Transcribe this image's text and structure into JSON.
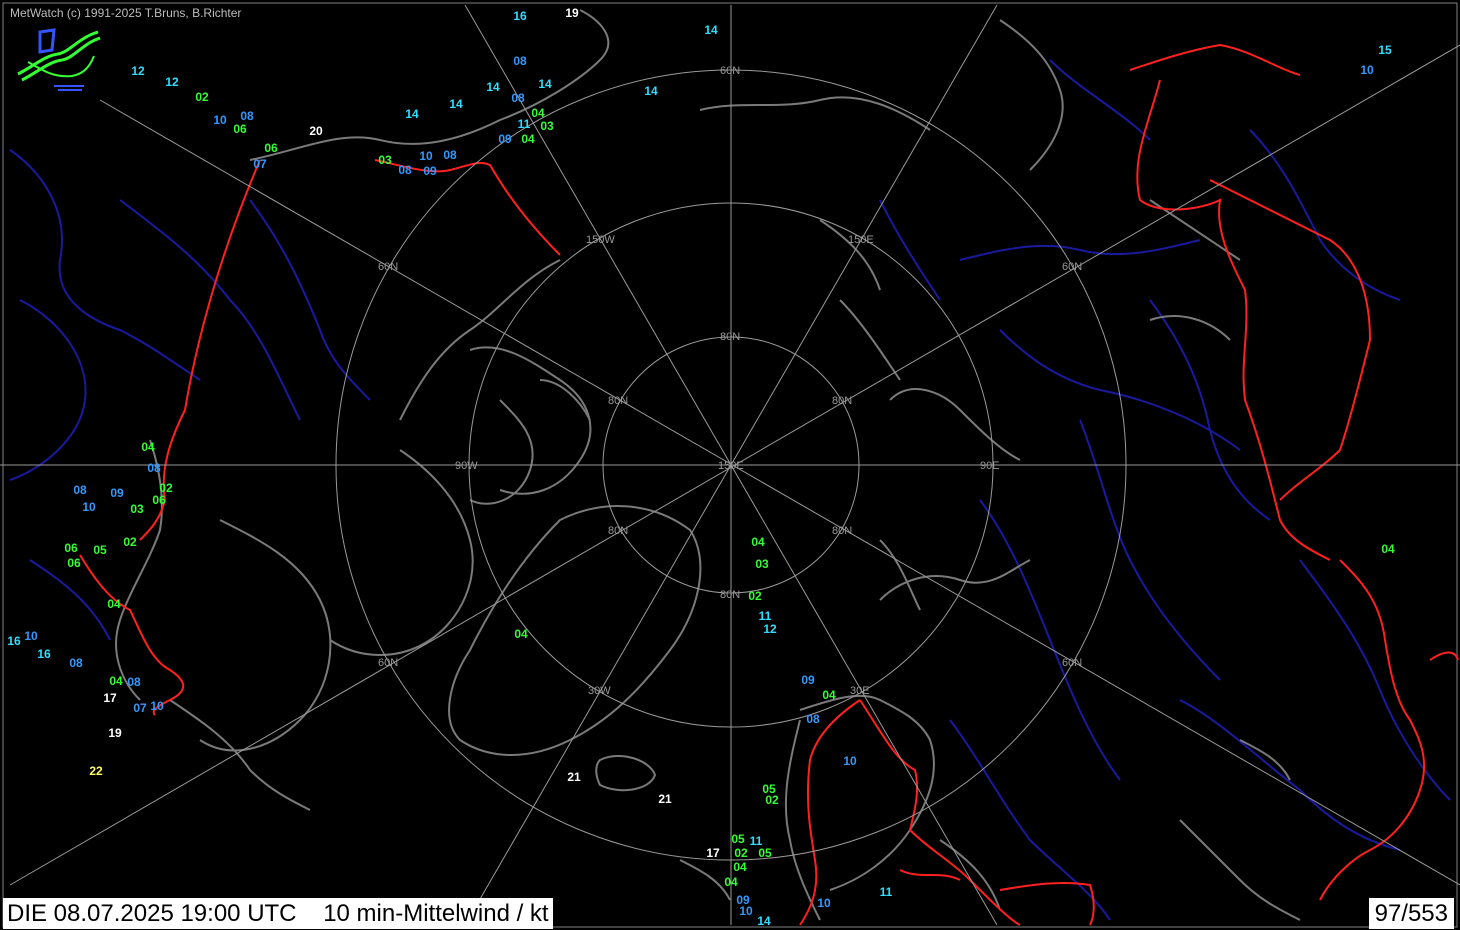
{
  "header": {
    "credit": "MetWatch  (c) 1991-2025 T.Bruns, B.Richter"
  },
  "footer": {
    "datetime": "DIE 08.07.2025 19:00 UTC",
    "product": "10 min-Mittelwind / kt",
    "counter": "97/553"
  },
  "grid_labels": {
    "lat60": "60N",
    "lat80": "80N",
    "center": "150E",
    "lon150w": "150W",
    "lon150e": "150E",
    "lon90w": "90W",
    "lon90e": "90E",
    "lon30w": "30W",
    "lon30e": "30E"
  },
  "colors": {
    "background": "#000000",
    "coastline": "#7a7a7a",
    "border": "#ff2020",
    "rivers": "#1a1a9e",
    "grid": "#9a9a9a",
    "wind_low": "#33ff33",
    "wind_mid": "#3399ff",
    "wind_high": "#33ddff",
    "wind_strong": "#ffffff",
    "wind_very_strong": "#ffff66"
  },
  "observations": [
    {
      "v": "16",
      "c": "wind_high"
    },
    {
      "v": "19",
      "c": "wind_strong"
    },
    {
      "v": "14",
      "c": "wind_high"
    },
    {
      "v": "08",
      "c": "wind_mid"
    },
    {
      "v": "14",
      "c": "wind_high"
    },
    {
      "v": "14",
      "c": "wind_high"
    },
    {
      "v": "08",
      "c": "wind_mid"
    },
    {
      "v": "04",
      "c": "wind_low"
    },
    {
      "v": "11",
      "c": "wind_high"
    },
    {
      "v": "03",
      "c": "wind_low"
    },
    {
      "v": "09",
      "c": "wind_mid"
    },
    {
      "v": "04",
      "c": "wind_low"
    },
    {
      "v": "14",
      "c": "wind_high"
    },
    {
      "v": "14",
      "c": "wind_high"
    },
    {
      "v": "14",
      "c": "wind_high"
    },
    {
      "v": "12",
      "c": "wind_high"
    },
    {
      "v": "12",
      "c": "wind_high"
    },
    {
      "v": "02",
      "c": "wind_low"
    },
    {
      "v": "10",
      "c": "wind_mid"
    },
    {
      "v": "08",
      "c": "wind_mid"
    },
    {
      "v": "06",
      "c": "wind_low"
    },
    {
      "v": "20",
      "c": "wind_strong"
    },
    {
      "v": "06",
      "c": "wind_low"
    },
    {
      "v": "07",
      "c": "wind_mid"
    },
    {
      "v": "03",
      "c": "wind_low"
    },
    {
      "v": "10",
      "c": "wind_mid"
    },
    {
      "v": "08",
      "c": "wind_mid"
    },
    {
      "v": "08",
      "c": "wind_mid"
    },
    {
      "v": "09",
      "c": "wind_mid"
    },
    {
      "v": "15",
      "c": "wind_high"
    },
    {
      "v": "10",
      "c": "wind_mid"
    },
    {
      "v": "04",
      "c": "wind_low"
    },
    {
      "v": "08",
      "c": "wind_mid"
    },
    {
      "v": "02",
      "c": "wind_low"
    },
    {
      "v": "06",
      "c": "wind_low"
    },
    {
      "v": "08",
      "c": "wind_mid"
    },
    {
      "v": "09",
      "c": "wind_mid"
    },
    {
      "v": "10",
      "c": "wind_mid"
    },
    {
      "v": "03",
      "c": "wind_low"
    },
    {
      "v": "02",
      "c": "wind_low"
    },
    {
      "v": "06",
      "c": "wind_low"
    },
    {
      "v": "05",
      "c": "wind_low"
    },
    {
      "v": "06",
      "c": "wind_low"
    },
    {
      "v": "04",
      "c": "wind_low"
    },
    {
      "v": "16",
      "c": "wind_high"
    },
    {
      "v": "10",
      "c": "wind_mid"
    },
    {
      "v": "16",
      "c": "wind_high"
    },
    {
      "v": "08",
      "c": "wind_mid"
    },
    {
      "v": "04",
      "c": "wind_low"
    },
    {
      "v": "08",
      "c": "wind_mid"
    },
    {
      "v": "17",
      "c": "wind_strong"
    },
    {
      "v": "07",
      "c": "wind_mid"
    },
    {
      "v": "10",
      "c": "wind_mid"
    },
    {
      "v": "19",
      "c": "wind_strong"
    },
    {
      "v": "22",
      "c": "wind_very_strong"
    },
    {
      "v": "04",
      "c": "wind_low"
    },
    {
      "v": "03",
      "c": "wind_low"
    },
    {
      "v": "02",
      "c": "wind_low"
    },
    {
      "v": "11",
      "c": "wind_high"
    },
    {
      "v": "12",
      "c": "wind_high"
    },
    {
      "v": "04",
      "c": "wind_low"
    },
    {
      "v": "04",
      "c": "wind_low"
    },
    {
      "v": "09",
      "c": "wind_mid"
    },
    {
      "v": "04",
      "c": "wind_low"
    },
    {
      "v": "08",
      "c": "wind_mid"
    },
    {
      "v": "10",
      "c": "wind_mid"
    },
    {
      "v": "21",
      "c": "wind_strong"
    },
    {
      "v": "21",
      "c": "wind_strong"
    },
    {
      "v": "05",
      "c": "wind_low"
    },
    {
      "v": "02",
      "c": "wind_low"
    },
    {
      "v": "05",
      "c": "wind_low"
    },
    {
      "v": "11",
      "c": "wind_high"
    },
    {
      "v": "17",
      "c": "wind_strong"
    },
    {
      "v": "02",
      "c": "wind_low"
    },
    {
      "v": "05",
      "c": "wind_low"
    },
    {
      "v": "04",
      "c": "wind_low"
    },
    {
      "v": "04",
      "c": "wind_low"
    },
    {
      "v": "09",
      "c": "wind_mid"
    },
    {
      "v": "10",
      "c": "wind_mid"
    },
    {
      "v": "10",
      "c": "wind_mid"
    },
    {
      "v": "14",
      "c": "wind_high"
    },
    {
      "v": "11",
      "c": "wind_high"
    }
  ]
}
